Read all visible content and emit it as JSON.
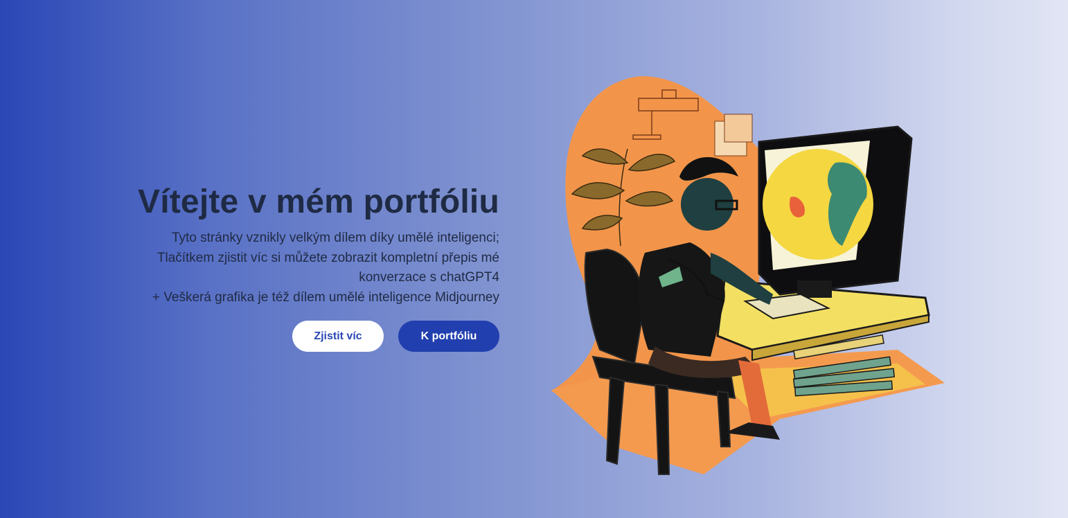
{
  "hero": {
    "title": "Vítejte v mém portfóliu",
    "description": [
      "Tyto stránky vznikly velkým dílem díky umělé inteligenci;",
      "Tlačítkem zjistit víc si můžete zobrazit kompletní přepis mé",
      "konverzace s chatGPT4",
      "+ Veškerá grafika je též dílem umělé inteligence Midjourney"
    ],
    "buttons": {
      "learn_more": "Zjistit víc",
      "portfolio": "K portfóliu"
    }
  },
  "colors": {
    "gradient_start": "#2a47b6",
    "gradient_end": "#e1e5f4",
    "heading": "#1f2a44",
    "primary_button": "#213fae",
    "secondary_button": "#ffffff"
  },
  "illustration": {
    "icon": "boy-at-computer-illustration"
  }
}
